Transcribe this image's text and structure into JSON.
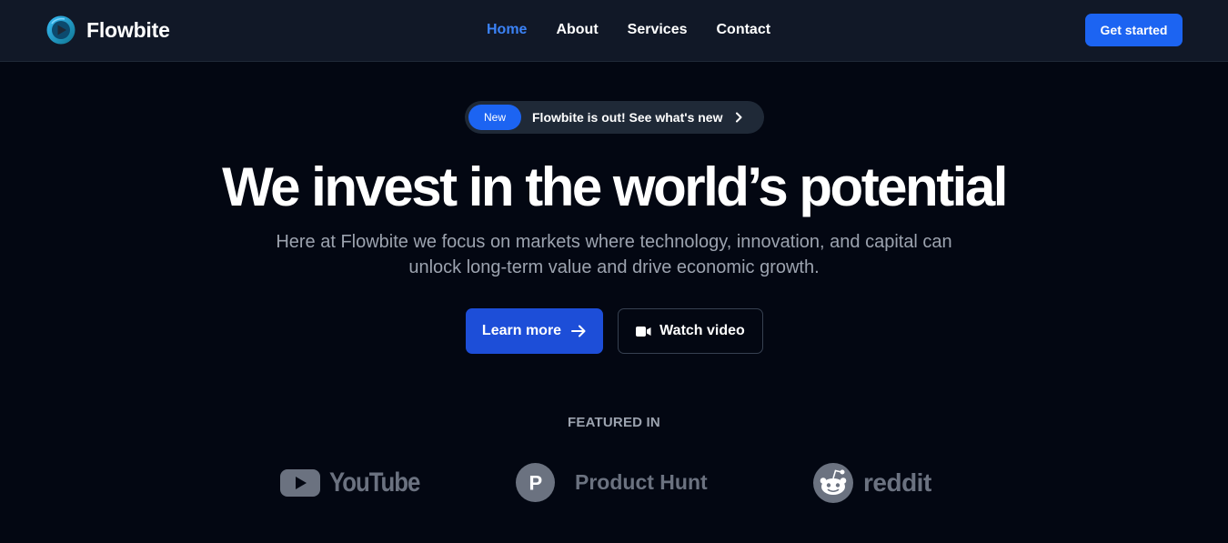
{
  "nav": {
    "brand": "Flowbite",
    "links": [
      {
        "label": "Home",
        "active": true
      },
      {
        "label": "About",
        "active": false
      },
      {
        "label": "Services",
        "active": false
      },
      {
        "label": "Contact",
        "active": false
      }
    ],
    "cta_label": "Get started"
  },
  "hero": {
    "announcement": {
      "badge": "New",
      "text": "Flowbite is out! See what's new"
    },
    "title": "We invest in the world’s potential",
    "subtitle": "Here at Flowbite we focus on markets where technology, innovation, and capital can unlock long-term value and drive economic growth.",
    "primary_button": "Learn more",
    "secondary_button": "Watch video"
  },
  "featured": {
    "label": "FEATURED IN",
    "logos": [
      {
        "name": "YouTube",
        "icon": "youtube-icon"
      },
      {
        "name": "Product Hunt",
        "icon": "producthunt-icon",
        "letter": "P"
      },
      {
        "name": "reddit",
        "icon": "reddit-icon"
      }
    ]
  },
  "colors": {
    "background": "#030712",
    "navbar": "#111827",
    "accent": "#1c64f2",
    "active_link": "#3b82f6",
    "muted_text": "#9ca3af",
    "logo_gray": "#6b7280"
  }
}
